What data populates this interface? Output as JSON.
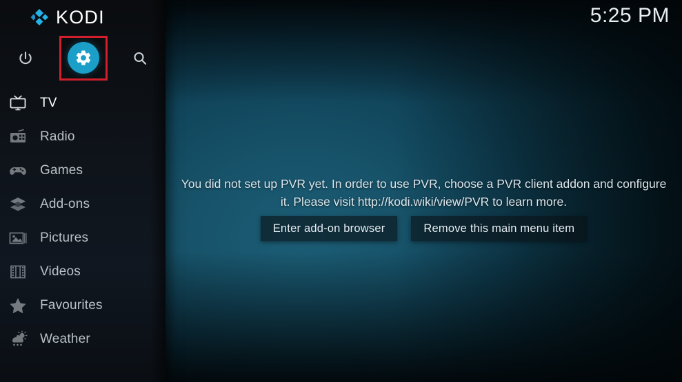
{
  "app": {
    "logo_text": "KODI",
    "logo_icon": "kodi-diamond-logo"
  },
  "header": {
    "clock": "5:25 PM",
    "icons": [
      {
        "name": "power-icon",
        "label": "Power"
      },
      {
        "name": "settings-gear-icon",
        "label": "Settings"
      },
      {
        "name": "search-icon",
        "label": "Search"
      }
    ],
    "highlight_color": "#d21f2b",
    "gear_accent_color": "#1b9fc9"
  },
  "sidebar": {
    "items": [
      {
        "label": "TV",
        "icon": "tv-icon",
        "active": true
      },
      {
        "label": "Radio",
        "icon": "radio-icon",
        "active": false
      },
      {
        "label": "Games",
        "icon": "gamepad-icon",
        "active": false
      },
      {
        "label": "Add-ons",
        "icon": "addons-box-icon",
        "active": false
      },
      {
        "label": "Pictures",
        "icon": "pictures-icon",
        "active": false
      },
      {
        "label": "Videos",
        "icon": "film-strip-icon",
        "active": false
      },
      {
        "label": "Favourites",
        "icon": "star-icon",
        "active": false
      },
      {
        "label": "Weather",
        "icon": "weather-icon",
        "active": false
      }
    ]
  },
  "main": {
    "message": "You did not set up PVR yet. In order to use PVR, choose a PVR client addon and configure it. Please visit http://kodi.wiki/view/PVR to learn more.",
    "buttons": [
      {
        "label": "Enter add-on browser"
      },
      {
        "label": "Remove this main menu item"
      }
    ]
  }
}
